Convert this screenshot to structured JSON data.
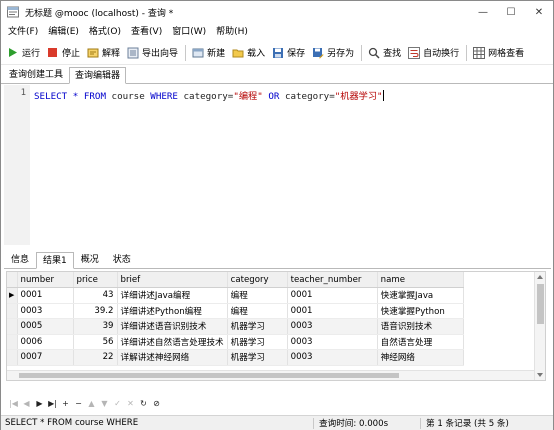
{
  "window": {
    "title": "无标题 @mooc (localhost) - 查询 *",
    "minimize_glyph": "—",
    "maximize_glyph": "☐",
    "close_glyph": "✕"
  },
  "menu": [
    "文件(F)",
    "编辑(E)",
    "格式(O)",
    "查看(V)",
    "窗口(W)",
    "帮助(H)"
  ],
  "toolbar": {
    "run": "运行",
    "stop": "停止",
    "explain": "解释",
    "export_wizard": "导出向导",
    "new": "新建",
    "load": "载入",
    "save": "保存",
    "save_as": "另存为",
    "find": "查找",
    "word_wrap": "自动换行",
    "grid_view": "网格查看"
  },
  "query_tabs": [
    "查询创建工具",
    "查询编辑器"
  ],
  "editor": {
    "line_number": "1",
    "kw_select": "SELECT",
    "star": "*",
    "kw_from": "FROM",
    "table": "course",
    "kw_where": "WHERE",
    "col1": "category",
    "eq": "=",
    "val1": "\"编程\"",
    "kw_or": "OR",
    "col2": "category",
    "val2": "\"机器学习\""
  },
  "result_tabs": [
    "信息",
    "结果1",
    "概况",
    "状态"
  ],
  "results": {
    "columns": [
      "number",
      "price",
      "brief",
      "category",
      "teacher_number",
      "name"
    ],
    "rows": [
      [
        "0001",
        "43",
        "详细讲述Java编程",
        "编程",
        "0001",
        "快速掌握Java"
      ],
      [
        "0003",
        "39.2",
        "详细讲述Python编程",
        "编程",
        "0001",
        "快速掌握Python"
      ],
      [
        "0005",
        "39",
        "详细讲述语音识别技术",
        "机器学习",
        "0003",
        "语音识别技术"
      ],
      [
        "0006",
        "56",
        "详细讲述自然语言处理技术",
        "机器学习",
        "0003",
        "自然语言处理"
      ],
      [
        "0007",
        "22",
        "详解讲述神经网络",
        "机器学习",
        "0003",
        "神经网络"
      ]
    ],
    "current_row_marker": "▶"
  },
  "nav": {
    "first": "|◀",
    "prev": "◀",
    "next": "▶",
    "last": "▶|",
    "add": "+",
    "delete": "−",
    "up": "▲",
    "down": "▼",
    "confirm": "✓",
    "cancel": "✕",
    "refresh": "↻",
    "stop": "⊘"
  },
  "status": {
    "query": "SELECT * FROM course WHERE",
    "time": "查询时间: 0.000s",
    "records": "第 1 条记录 (共 5 条)"
  },
  "colors": {
    "keyword": "#0000cc",
    "string": "#b40000",
    "run_green": "#2e9e2e",
    "stop_red": "#d93a2b"
  }
}
